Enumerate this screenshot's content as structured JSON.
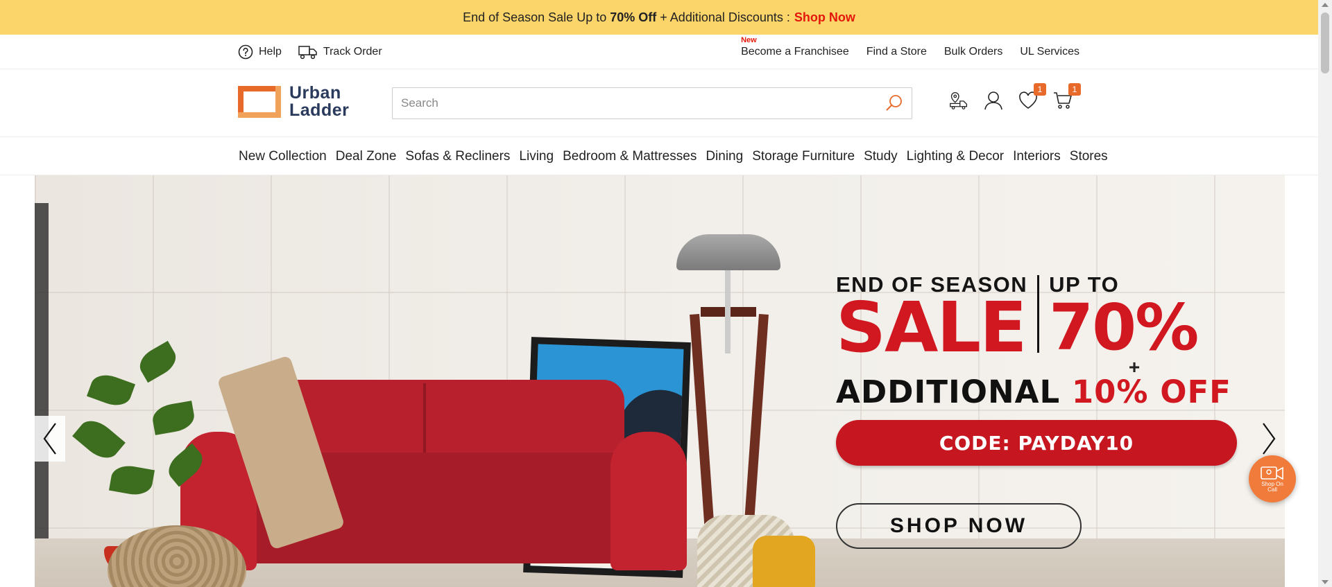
{
  "promo": {
    "text_before": "End of Season Sale Up to",
    "bold": "70% Off",
    "text_after": "+ Additional Discounts :",
    "link": "Shop Now"
  },
  "utility": {
    "help": "Help",
    "track_order": "Track Order",
    "new_tag": "New",
    "franchise": "Become a Franchisee",
    "find_store": "Find a Store",
    "bulk_orders": "Bulk Orders",
    "ul_services": "UL Services"
  },
  "header": {
    "logo_line1": "Urban",
    "logo_line2": "Ladder",
    "search_placeholder": "Search",
    "wishlist_count": "1",
    "cart_count": "1"
  },
  "nav": {
    "items": [
      "New Collection",
      "Deal Zone",
      "Sofas & Recliners",
      "Living",
      "Bedroom & Mattresses",
      "Dining",
      "Storage Furniture",
      "Study",
      "Lighting & Decor",
      "Interiors",
      "Stores"
    ]
  },
  "hero": {
    "line1_left": "END OF SEASON",
    "line1_right": "UP TO",
    "sale": "SALE",
    "percent": "70%",
    "plus": "+",
    "additional": "ADDITIONAL",
    "additional_off": "10% OFF",
    "code": "CODE: PAYDAY10",
    "cta": "SHOP NOW"
  },
  "shop_on_call": "Shop On Call",
  "colors": {
    "promo_bg": "#fbd46a",
    "accent": "#e86a2a",
    "sale_red": "#d1171f"
  }
}
